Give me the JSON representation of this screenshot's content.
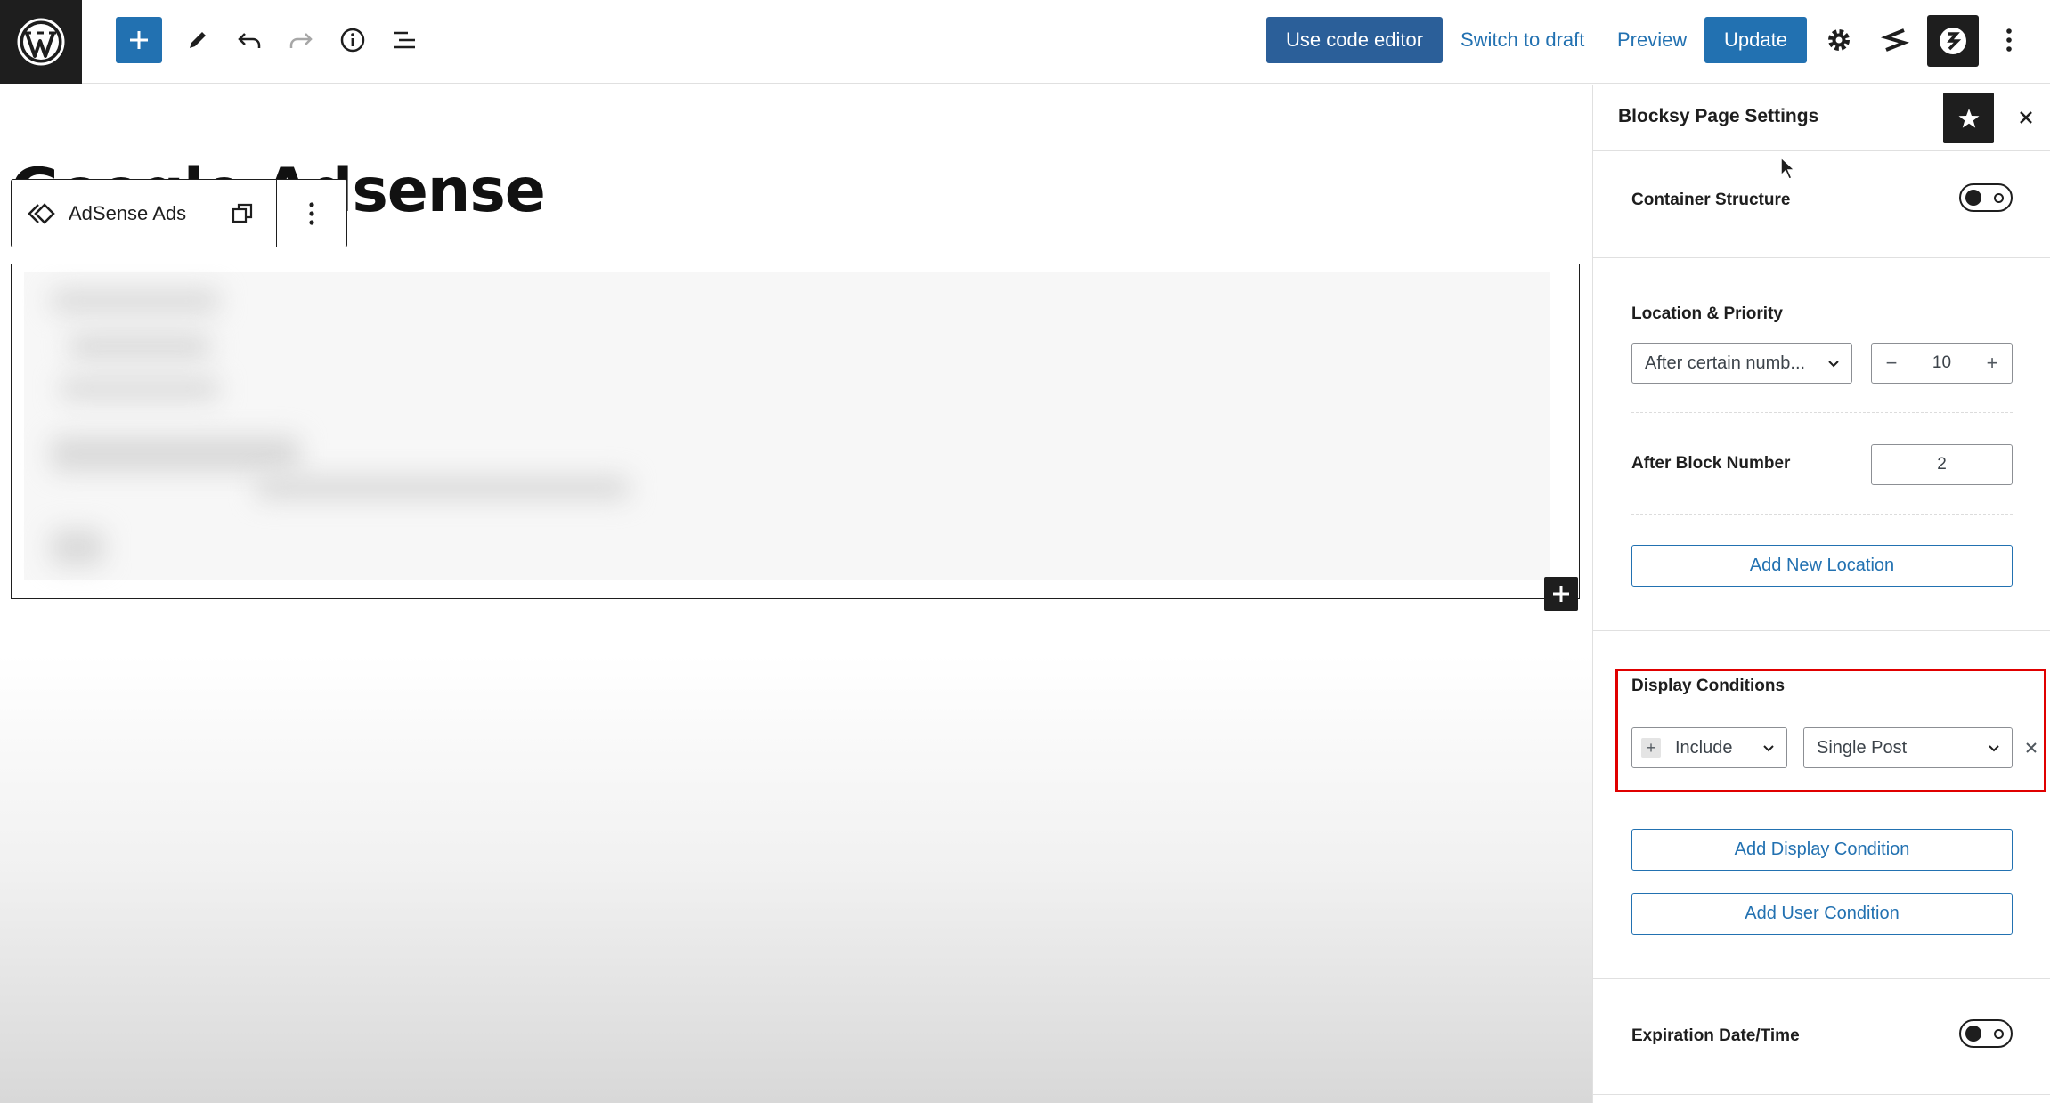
{
  "topbar": {
    "code_editor_label": "Use code editor",
    "switch_draft_label": "Switch to draft",
    "preview_label": "Preview",
    "update_label": "Update"
  },
  "editor": {
    "post_title": "Google Adsense",
    "block_toolbar": {
      "block_name": "AdSense Ads"
    }
  },
  "sidebar": {
    "title": "Blocksy Page Settings",
    "container_structure_label": "Container Structure",
    "container_structure_enabled": false,
    "location_priority_label": "Location & Priority",
    "location_select_value": "After certain numb...",
    "priority_value": "10",
    "after_block_number_label": "After Block Number",
    "after_block_number_value": "2",
    "add_new_location_label": "Add New Location",
    "display_conditions_label": "Display Conditions",
    "condition_type_value": "Include",
    "condition_target_value": "Single Post",
    "add_display_condition_label": "Add Display Condition",
    "add_user_condition_label": "Add User Condition",
    "expiration_label": "Expiration Date/Time",
    "expiration_enabled": false
  },
  "colors": {
    "accent": "#2271b1",
    "dark": "#1e1e1e",
    "highlight": "#e00000"
  }
}
